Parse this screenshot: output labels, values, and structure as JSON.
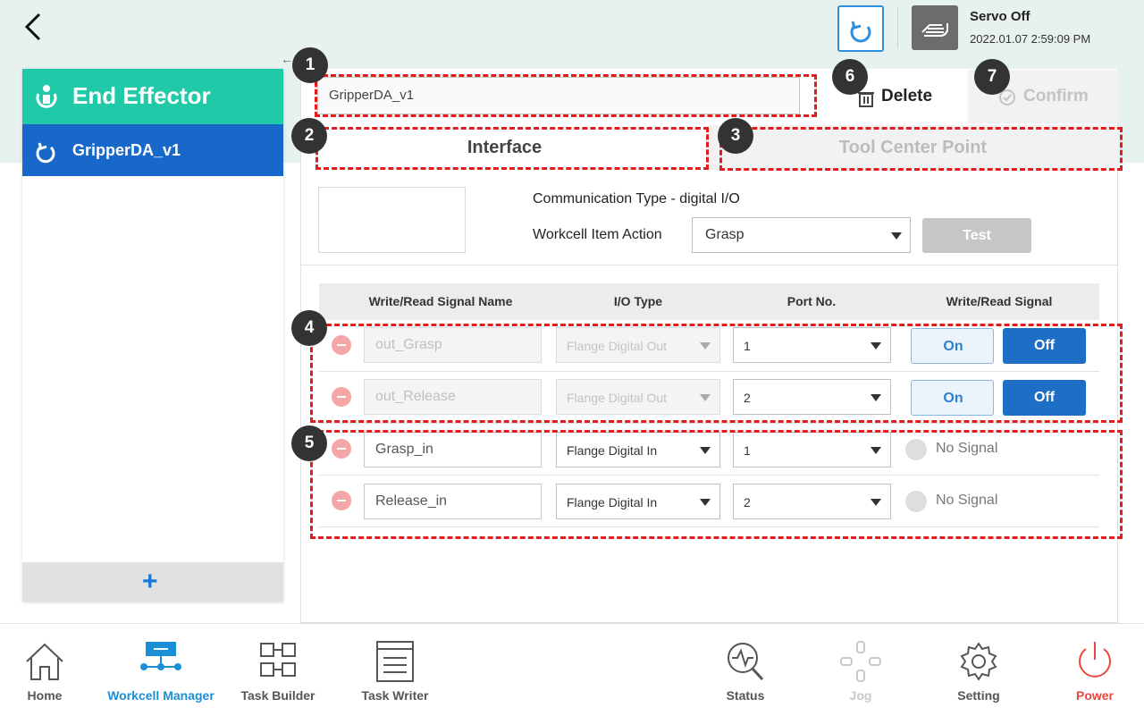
{
  "header": {
    "servo_status": "Servo Off",
    "timestamp": "2022.01.07 2:59:09 PM"
  },
  "sidebar": {
    "title": "End Effector",
    "items": [
      {
        "label": "GripperDA_v1"
      }
    ],
    "add_label": "+"
  },
  "editor": {
    "name_value": "GripperDA_v1",
    "delete_label": "Delete",
    "confirm_label": "Confirm",
    "tabs": [
      {
        "label": "Interface"
      },
      {
        "label": "Tool Center Point"
      }
    ],
    "communication_type": "Communication Type - digital I/O",
    "action_label": "Workcell Item Action",
    "action_value": "Grasp",
    "test_label": "Test"
  },
  "signal_table": {
    "headers": [
      "Write/Read Signal Name",
      "I/O Type",
      "Port No.",
      "Write/Read Signal"
    ],
    "rows": [
      {
        "name": "out_Grasp",
        "io_type": "Flange Digital Out",
        "port": "1",
        "on": "On",
        "off": "Off"
      },
      {
        "name": "out_Release",
        "io_type": "Flange Digital Out",
        "port": "2",
        "on": "On",
        "off": "Off"
      },
      {
        "name": "Grasp_in",
        "io_type": "Flange Digital In",
        "port": "1",
        "signal": "No Signal"
      },
      {
        "name": "Release_in",
        "io_type": "Flange Digital In",
        "port": "2",
        "signal": "No Signal"
      }
    ]
  },
  "callouts": [
    "1",
    "2",
    "3",
    "4",
    "5",
    "6",
    "7"
  ],
  "bottom_nav": [
    {
      "label": "Home"
    },
    {
      "label": "Workcell Manager"
    },
    {
      "label": "Task Builder"
    },
    {
      "label": "Task Writer"
    },
    {
      "label": "Status"
    },
    {
      "label": "Jog"
    },
    {
      "label": "Setting"
    },
    {
      "label": "Power"
    }
  ],
  "colors": {
    "teal": "#20c9a7",
    "blue": "#1868c9",
    "callout_red": "#e21c1c",
    "power_red": "#e8483f",
    "active_nav": "#1b8fd6"
  }
}
